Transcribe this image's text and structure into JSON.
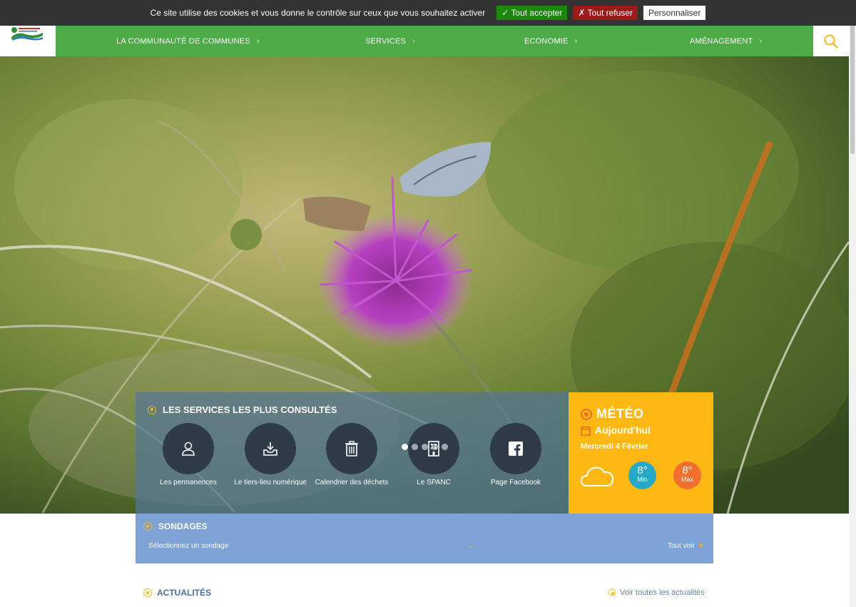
{
  "cookie_bar": {
    "text": "Ce site utilise des cookies et vous donne le contrôle sur ceux que vous souhaitez activer",
    "accept_label": "✓ Tout accepter",
    "refuse_label": "✗ Tout refuser",
    "custom_label": "Personnaliser"
  },
  "nav": {
    "items": [
      {
        "label": "LA COMMUNAUTÉ DE COMMUNES",
        "icon": "chevron-right-icon"
      },
      {
        "label": "SERVICES",
        "icon": "chevron-right-icon"
      },
      {
        "label": "ECONOMIE",
        "icon": "chevron-right-icon"
      },
      {
        "label": "AMÉNAGEMENT",
        "icon": "chevron-right-icon"
      }
    ],
    "chevron": "›",
    "search_icon": "search-icon"
  },
  "slider": {
    "slide_count": 5,
    "active_index": 0
  },
  "services": {
    "title": "LES SERVICES LES PLUS CONSULTÉS",
    "items": [
      {
        "label": "Les permanences",
        "icon": "user-icon"
      },
      {
        "label": "Le tiers-lieu numérique",
        "icon": "download-tray-icon"
      },
      {
        "label": "Calendrier des déchets",
        "icon": "trash-icon"
      },
      {
        "label": "Le SPANC",
        "icon": "building-icon"
      },
      {
        "label": "Page Facebook",
        "icon": "facebook-icon"
      }
    ]
  },
  "meteo": {
    "title": "MÉTÉO",
    "today_label": "Aujourd'hui",
    "date": "Mercredi 4 Février",
    "min_value": "8°",
    "min_label": "Min",
    "max_value": "8°",
    "max_label": "Max",
    "weather_icon": "cloud-icon"
  },
  "sondages": {
    "title": "SONDAGES",
    "select_placeholder": "Sélectionnez un sondage",
    "chevron": "⌄",
    "see_all_label": "Tout voir",
    "plus": "+"
  },
  "actualites": {
    "title": "ACTUALITÉS",
    "see_all_label": "Voir toutes les actualités"
  },
  "colors": {
    "nav_green": "#4dac48",
    "accent_yellow": "#f2b81d",
    "meteo_yellow": "#fdb813",
    "temp_min": "#26a9c6",
    "temp_max": "#f36f2d",
    "sondages_blue": "#7da3d4"
  }
}
